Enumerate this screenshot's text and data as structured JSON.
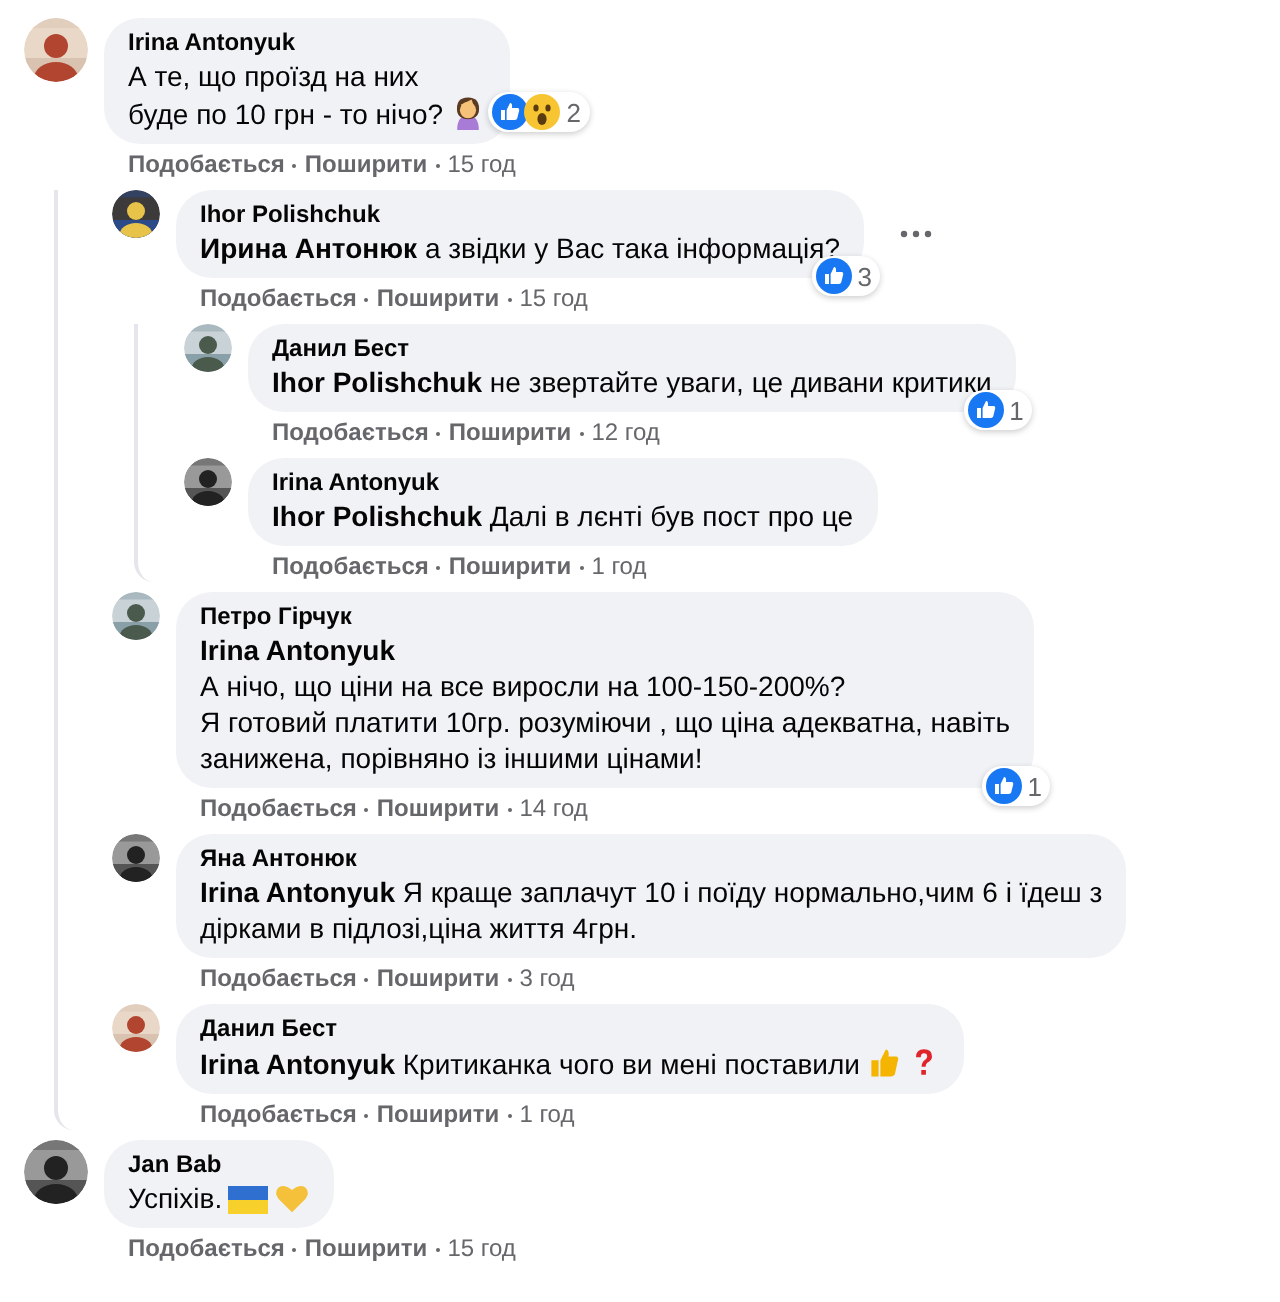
{
  "comments": [
    {
      "author": "Irina Antonyuk",
      "text": "А те, що проїзд на них\nбуде по 10 грн - то нічо?",
      "emojis": [
        {
          "kind": "facepalm"
        }
      ],
      "reactions": {
        "icons": [
          {
            "kind": "like"
          },
          {
            "kind": "wow"
          }
        ],
        "count": "2"
      },
      "like": "Подобається",
      "share": "Поширити",
      "time": "15 год",
      "children": [
        {
          "author": "Ihor Polishchuk",
          "text": "**Ирина Антонюк** а звідки у Вас така інформація?",
          "menu": true,
          "reactions": {
            "icons": [
              {
                "kind": "like"
              }
            ],
            "count": "3"
          },
          "like": "Подобається",
          "share": "Поширити",
          "time": "15 год",
          "children": [
            {
              "author": "Данил Бест",
              "text": "**Ihor Polishchuk** не звертайте уваги, це дивани критики",
              "reactions": {
                "icons": [
                  {
                    "kind": "like"
                  }
                ],
                "count": "1"
              },
              "like": "Подобається",
              "share": "Поширити",
              "time": "12 год"
            },
            {
              "author": "Irina Antonyuk",
              "text": "**Ihor Polishchuk** Далі в лєнті був пост про це",
              "like": "Подобається",
              "share": "Поширити",
              "time": "1 год"
            }
          ]
        },
        {
          "author": "Петро Гірчук",
          "text": "**Irina Antonyuk**\nА нічо, що ціни на все виросли на 100-150-200%?\nЯ готовий платити 10гр. розуміючи , що ціна адекватна, навіть\nзанижена, порівняно із іншими цінами!",
          "reactions": {
            "icons": [
              {
                "kind": "like"
              }
            ],
            "count": "1"
          },
          "like": "Подобається",
          "share": "Поширити",
          "time": "14 год"
        },
        {
          "author": "Яна Антонюк",
          "text": "**Irina Antonyuk** Я краще заплачут 10 і поїду нормально,чим 6 і їдеш з\nдірками в підлозі,ціна життя 4грн.",
          "like": "Подобається",
          "share": "Поширити",
          "time": "3 год"
        },
        {
          "author": "Данил Бест",
          "text": "**Irina Antonyuk** Критиканка чого ви мені поставили",
          "emojis": [
            {
              "kind": "thumbs"
            },
            {
              "kind": "question"
            }
          ],
          "like": "Подобається",
          "share": "Поширити",
          "time": "1 год"
        }
      ]
    },
    {
      "author": "Jan Bab",
      "text": "Успіхів.",
      "emojis": [
        {
          "kind": "flag"
        },
        {
          "kind": "heart"
        }
      ],
      "like": "Подобається",
      "share": "Поширити",
      "time": "15 год"
    }
  ]
}
